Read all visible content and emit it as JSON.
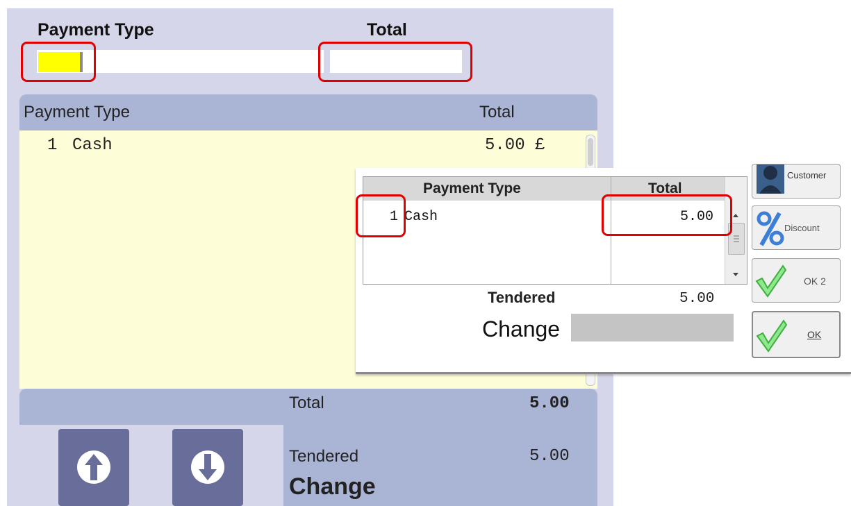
{
  "header": {
    "payment_type_label": "Payment Type",
    "total_label": "Total"
  },
  "list": {
    "columns": [
      "Payment Type",
      "Total"
    ],
    "rows": [
      {
        "index": "1",
        "type": "Cash",
        "total": "5.00 £"
      }
    ]
  },
  "totals": {
    "total_label": "Total",
    "total_value": "5.00",
    "tendered_label": "Tendered",
    "tendered_value": "5.00",
    "change_label": "Change"
  },
  "nav": {
    "up_icon": "arrow-up-icon",
    "down_icon": "arrow-down-icon"
  },
  "dialog": {
    "columns": [
      "Payment Type",
      "Total"
    ],
    "rows": [
      {
        "index": "1",
        "type": "Cash",
        "total": "5.00"
      }
    ],
    "tendered_label": "Tendered",
    "tendered_value": "5.00",
    "change_label": "Change",
    "buttons": {
      "customer": "Customer",
      "discount": "Discount",
      "ok2": "OK 2",
      "ok": "OK"
    }
  },
  "colors": {
    "panel_bg": "#d6d6ea",
    "header_bar": "#aab5d6",
    "list_bg": "#fdfdd8",
    "highlight_red": "#e00000",
    "selection_yellow": "#ffff00",
    "nav_button": "#686d99",
    "check_green": "#7dd87d"
  }
}
